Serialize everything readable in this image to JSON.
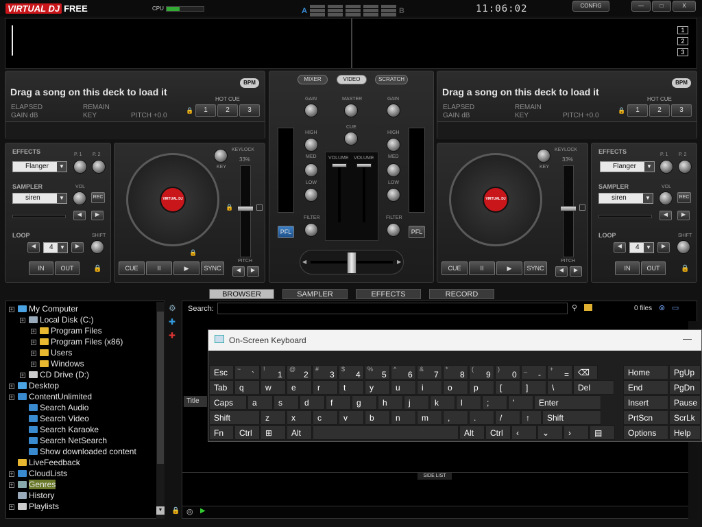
{
  "app": {
    "logo_main": "VIRTUAL DJ",
    "logo_sub": "FREE",
    "cpu_label": "CPU",
    "cpu_level": 0.35,
    "deck_a": "A",
    "deck_b": "B",
    "clock": "11:06:02",
    "config": "CONFIG",
    "minimize": "—",
    "maximize": "□",
    "close": "X",
    "zoom": [
      "1",
      "2",
      "3"
    ]
  },
  "deck_left": {
    "title": "Drag a song on this deck to load it",
    "elapsed": "ELAPSED",
    "gain": "GAIN dB",
    "remain": "REMAIN",
    "key": "KEY",
    "pitch": "PITCH +0.0",
    "bpm": "BPM",
    "hot_cue": "HOT CUE",
    "hot_cue_buttons": [
      "1",
      "2",
      "3"
    ],
    "effects_label": "EFFECTS",
    "effect": "Flanger",
    "p1": "P. 1",
    "p2": "P. 2",
    "sampler_label": "SAMPLER",
    "sample": "siren",
    "vol": "VOL",
    "rec": "REC",
    "loop_label": "LOOP",
    "loop_value": "4",
    "shift": "SHIFT",
    "in": "IN",
    "out": "OUT",
    "keylock": "KEYLOCK",
    "keylock_pct": "33%",
    "key_knob": "KEY",
    "pitch_label": "PITCH",
    "cue": "CUE",
    "pause": "II",
    "play": "▶",
    "sync": "SYNC",
    "disc_label": "VIRTUAL DJ"
  },
  "deck_right": {
    "title": "Drag a song on this deck to load it",
    "elapsed": "ELAPSED",
    "gain": "GAIN dB",
    "remain": "REMAIN",
    "key": "KEY",
    "pitch": "PITCH +0.0",
    "bpm": "BPM",
    "hot_cue": "HOT CUE",
    "hot_cue_buttons": [
      "1",
      "2",
      "3"
    ],
    "effects_label": "EFFECTS",
    "effect": "Flanger",
    "p1": "P. 1",
    "p2": "P. 2",
    "sampler_label": "SAMPLER",
    "sample": "siren",
    "vol": "VOL",
    "rec": "REC",
    "loop_label": "LOOP",
    "loop_value": "4",
    "shift": "SHIFT",
    "in": "IN",
    "out": "OUT",
    "keylock": "KEYLOCK",
    "keylock_pct": "33%",
    "key_knob": "KEY",
    "pitch_label": "PITCH",
    "cue": "CUE",
    "pause": "II",
    "play": "▶",
    "sync": "SYNC",
    "disc_label": "VIRTUAL DJ"
  },
  "mixer": {
    "tabs": [
      "MIXER",
      "VIDEO",
      "SCRATCH"
    ],
    "gain": "GAIN",
    "master": "MASTER",
    "cue": "CUE",
    "high": "HIGH",
    "med": "MED",
    "low": "LOW",
    "volume": "VOLUME",
    "filter": "FILTER",
    "pfl": "PFL"
  },
  "browser_tabs": [
    "BROWSER",
    "SAMPLER",
    "EFFECTS",
    "RECORD"
  ],
  "tree": [
    {
      "label": "My Computer",
      "icon": "computer-icon"
    },
    {
      "label": "Local Disk (C:)",
      "icon": "drive-icon"
    },
    {
      "label": "Program Files",
      "icon": "folder-icon"
    },
    {
      "label": "Program Files (x86)",
      "icon": "folder-icon"
    },
    {
      "label": "Users",
      "icon": "folder-icon"
    },
    {
      "label": "Windows",
      "icon": "folder-icon"
    },
    {
      "label": "CD Drive (D:)",
      "icon": "cd-icon"
    },
    {
      "label": "Desktop",
      "icon": "desktop-icon"
    },
    {
      "label": "ContentUnlimited",
      "icon": "globe-icon"
    },
    {
      "label": "Search Audio",
      "icon": "globe-icon"
    },
    {
      "label": "Search Video",
      "icon": "globe-icon"
    },
    {
      "label": "Search Karaoke",
      "icon": "globe-icon"
    },
    {
      "label": "Search NetSearch",
      "icon": "globe-icon"
    },
    {
      "label": "Show downloaded content",
      "icon": "globe-icon"
    },
    {
      "label": "LiveFeedback",
      "icon": "folder-icon"
    },
    {
      "label": "CloudLists",
      "icon": "globe-icon"
    },
    {
      "label": "Genres",
      "icon": "stack-icon"
    },
    {
      "label": "History",
      "icon": "book-icon"
    },
    {
      "label": "Playlists",
      "icon": "list-icon"
    }
  ],
  "browser": {
    "search_label": "Search:",
    "files": "0 files",
    "title_col": "Title",
    "side_list": "SIDE LIST"
  },
  "osk": {
    "title": "On-Screen Keyboard",
    "minimize": "—",
    "row1": [
      [
        "Esc",
        ""
      ],
      [
        "`",
        "~"
      ],
      [
        "1",
        "!"
      ],
      [
        "2",
        "@"
      ],
      [
        "3",
        "#"
      ],
      [
        "4",
        "$"
      ],
      [
        "5",
        "%"
      ],
      [
        "6",
        "^"
      ],
      [
        "7",
        "&"
      ],
      [
        "8",
        "*"
      ],
      [
        "9",
        "("
      ],
      [
        "0",
        ")"
      ],
      [
        "-",
        "_"
      ],
      [
        "=",
        "+"
      ],
      [
        "⌫",
        ""
      ]
    ],
    "row2": [
      "Tab",
      "q",
      "w",
      "e",
      "r",
      "t",
      "y",
      "u",
      "i",
      "o",
      "p",
      "[",
      "]",
      "\\",
      "Del"
    ],
    "row3": [
      "Caps",
      "a",
      "s",
      "d",
      "f",
      "g",
      "h",
      "j",
      "k",
      "l",
      ";",
      "'",
      "Enter"
    ],
    "row4": [
      "Shift",
      "z",
      "x",
      "c",
      "v",
      "b",
      "n",
      "m",
      ",",
      ".",
      "/",
      "↑",
      "Shift"
    ],
    "row5": [
      "Fn",
      "Ctrl",
      "⊞",
      "Alt",
      "",
      "Alt",
      "Ctrl",
      "‹",
      "⌄",
      "›",
      "▤"
    ],
    "side": [
      "Home",
      "PgUp",
      "End",
      "PgDn",
      "Insert",
      "Pause",
      "PrtScn",
      "ScrLk",
      "Options",
      "Help"
    ]
  }
}
